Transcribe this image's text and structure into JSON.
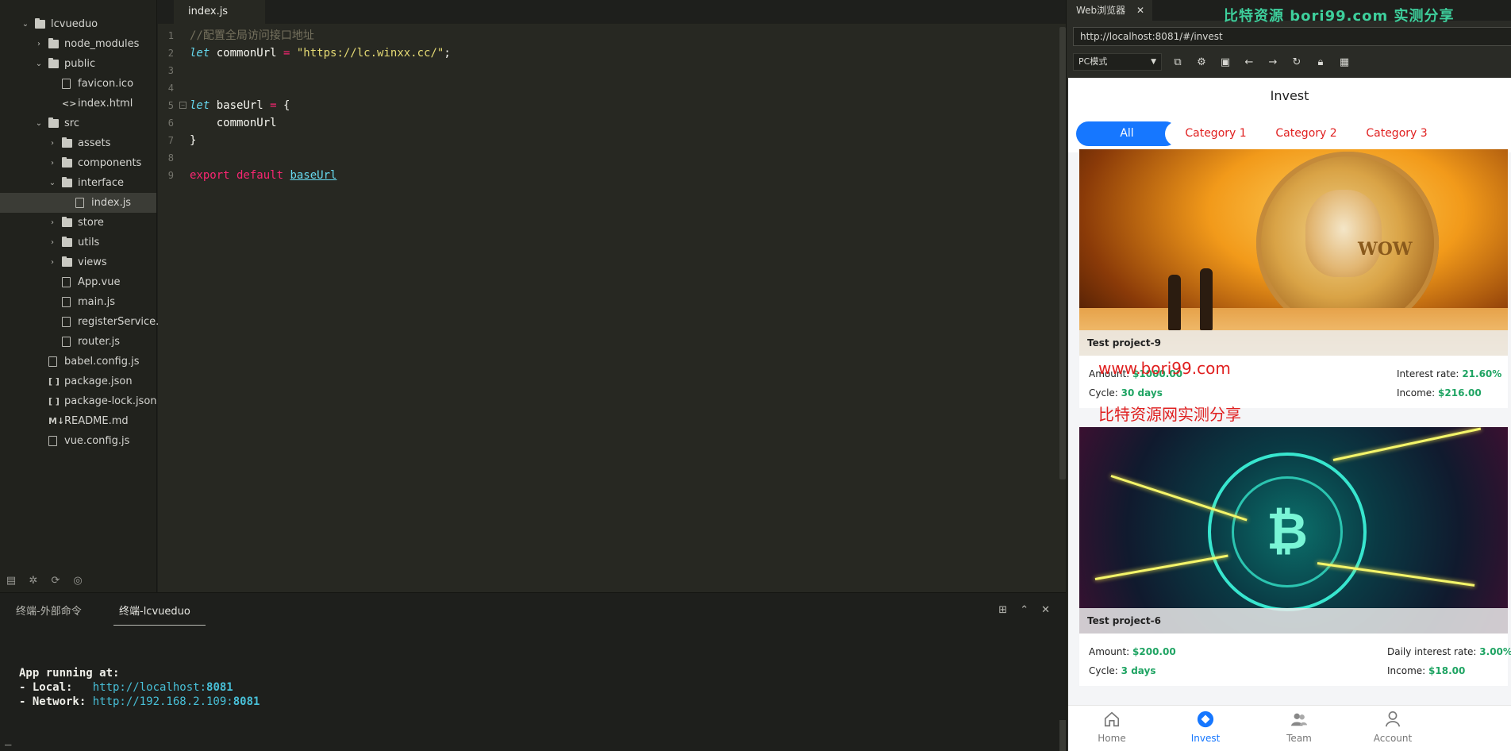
{
  "explorer": {
    "items": [
      {
        "label": "lcvueduo",
        "depth": 0,
        "kind": "folder",
        "open": true
      },
      {
        "label": "node_modules",
        "depth": 1,
        "kind": "folder",
        "open": false
      },
      {
        "label": "public",
        "depth": 1,
        "kind": "folder",
        "open": true
      },
      {
        "label": "favicon.ico",
        "depth": 2,
        "kind": "image"
      },
      {
        "label": "index.html",
        "depth": 2,
        "kind": "code"
      },
      {
        "label": "src",
        "depth": 1,
        "kind": "folder",
        "open": true
      },
      {
        "label": "assets",
        "depth": 2,
        "kind": "folder",
        "open": false
      },
      {
        "label": "components",
        "depth": 2,
        "kind": "folder",
        "open": false
      },
      {
        "label": "interface",
        "depth": 2,
        "kind": "folder",
        "open": true
      },
      {
        "label": "index.js",
        "depth": 3,
        "kind": "file",
        "selected": true
      },
      {
        "label": "store",
        "depth": 2,
        "kind": "folder",
        "open": false
      },
      {
        "label": "utils",
        "depth": 2,
        "kind": "folder",
        "open": false
      },
      {
        "label": "views",
        "depth": 2,
        "kind": "folder",
        "open": false
      },
      {
        "label": "App.vue",
        "depth": 2,
        "kind": "file"
      },
      {
        "label": "main.js",
        "depth": 2,
        "kind": "file"
      },
      {
        "label": "registerService...",
        "depth": 2,
        "kind": "file"
      },
      {
        "label": "router.js",
        "depth": 2,
        "kind": "file"
      },
      {
        "label": "babel.config.js",
        "depth": 1,
        "kind": "file"
      },
      {
        "label": "package.json",
        "depth": 1,
        "kind": "json"
      },
      {
        "label": "package-lock.json",
        "depth": 1,
        "kind": "json"
      },
      {
        "label": "README.md",
        "depth": 1,
        "kind": "md"
      },
      {
        "label": "vue.config.js",
        "depth": 1,
        "kind": "file"
      }
    ]
  },
  "editor": {
    "tab_label": "index.js",
    "lines": [
      {
        "n": "1",
        "comment": "//配置全局访问接口地址"
      },
      {
        "n": "2",
        "kw": "let",
        "rest1": " commonUrl ",
        "op": "=",
        "str": " \"https://lc.winxx.cc/\"",
        "rest2": ";"
      },
      {
        "n": "3"
      },
      {
        "n": "4"
      },
      {
        "n": "5",
        "kw": "let",
        "rest1": " baseUrl ",
        "op": "=",
        "rest2": " {",
        "fold": true
      },
      {
        "n": "6",
        "rest1": "    commonUrl"
      },
      {
        "n": "7",
        "rest1": "}"
      },
      {
        "n": "8"
      },
      {
        "n": "9",
        "exp": "export default",
        "link": "baseUrl"
      }
    ]
  },
  "terminal": {
    "tab_external": "终端-外部命令",
    "tab_project": "终端-lcvueduo",
    "line1": "App running at:",
    "local_label": "- Local:   ",
    "local_url": "http://localhost:",
    "local_port": "8081",
    "network_label": "- Network: ",
    "network_url": "http://192.168.2.109:",
    "network_port": "8081",
    "cursor": "_"
  },
  "browser": {
    "tab_label": "Web浏览器",
    "banner": "比特资源 bori99.com 实测分享",
    "url": "http://localhost:8081/#/invest",
    "mode": "PC模式"
  },
  "app": {
    "title": "Invest",
    "categories": [
      "All",
      "Category 1",
      "Category 2",
      "Category 3"
    ],
    "projects": [
      {
        "name": "Test project-9",
        "amount_label": "Amount:",
        "amount": "$1000.00",
        "cycle_label": "Cycle:",
        "cycle": "30 days",
        "rate_label": "Interest rate:",
        "rate": "21.60%",
        "income_label": "Income:",
        "income": "$216.00"
      },
      {
        "name": "Test project-6",
        "amount_label": "Amount:",
        "amount": "$200.00",
        "cycle_label": "Cycle:",
        "cycle": "3 days",
        "rate_label": "Daily interest rate:",
        "rate": "3.00%",
        "income_label": "Income:",
        "income": "$18.00"
      }
    ],
    "watermark_line1": "www.bori99.com",
    "watermark_line2": "比特资源网实测分享",
    "coin_text": "WOW",
    "tabbar": [
      "Home",
      "Invest",
      "Team",
      "Account"
    ]
  },
  "colors": {
    "accent": "#1677ff",
    "green": "#1fa463",
    "red": "#e02020",
    "banner": "#3ecf9c"
  }
}
